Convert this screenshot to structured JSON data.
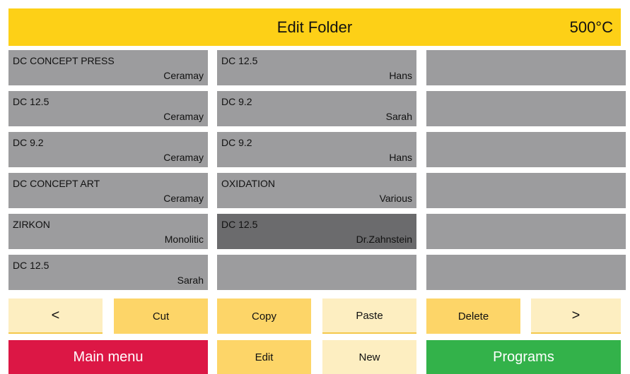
{
  "header": {
    "title": "Edit Folder",
    "temperature": "500°C"
  },
  "programs": [
    [
      {
        "name": "DC CONCEPT PRESS",
        "owner": "Ceramay"
      },
      {
        "name": "DC 12.5",
        "owner": "Ceramay"
      },
      {
        "name": "DC 9.2",
        "owner": "Ceramay"
      },
      {
        "name": "DC CONCEPT ART",
        "owner": "Ceramay"
      },
      {
        "name": "ZIRKON",
        "owner": "Monolitic"
      },
      {
        "name": "DC 12.5",
        "owner": "Sarah"
      }
    ],
    [
      {
        "name": "DC 12.5",
        "owner": "Hans"
      },
      {
        "name": "DC 9.2",
        "owner": "Sarah"
      },
      {
        "name": "DC 9.2",
        "owner": "Hans"
      },
      {
        "name": "OXIDATION",
        "owner": "Various"
      },
      {
        "name": "DC 12.5",
        "owner": "Dr.Zahnstein",
        "selected": true
      },
      {
        "name": "",
        "owner": ""
      }
    ],
    [
      {
        "name": "",
        "owner": ""
      },
      {
        "name": "",
        "owner": ""
      },
      {
        "name": "",
        "owner": ""
      },
      {
        "name": "",
        "owner": ""
      },
      {
        "name": "",
        "owner": ""
      },
      {
        "name": "",
        "owner": ""
      }
    ]
  ],
  "toolbar": {
    "prev": "<",
    "cut": "Cut",
    "copy": "Copy",
    "paste": "Paste",
    "delete": "Delete",
    "next": ">"
  },
  "footer": {
    "main_menu": "Main menu",
    "edit": "Edit",
    "new": "New",
    "programs": "Programs"
  },
  "colors": {
    "header": "#fdd017",
    "cell": "#9c9c9e",
    "cell_selected": "#6b6b6d",
    "button_light": "#fdeec1",
    "button_gold": "#fdd568",
    "main_menu": "#dc1745",
    "programs": "#33b24a"
  }
}
